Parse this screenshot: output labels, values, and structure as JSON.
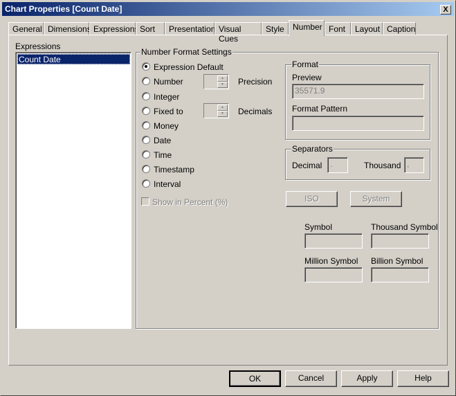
{
  "window": {
    "title": "Chart Properties [Count Date]",
    "close": "X"
  },
  "tabs": [
    "General",
    "Dimensions",
    "Expressions",
    "Sort",
    "Presentation",
    "Visual Cues",
    "Style",
    "Number",
    "Font",
    "Layout",
    "Caption"
  ],
  "expressions": {
    "label": "Expressions",
    "items": [
      "Count Date"
    ]
  },
  "number_format": {
    "label": "Number Format Settings",
    "options": [
      "Expression Default",
      "Number",
      "Integer",
      "Fixed to",
      "Money",
      "Date",
      "Time",
      "Timestamp",
      "Interval"
    ],
    "selected": "Expression Default",
    "precision_label": "Precision",
    "decimals_label": "Decimals",
    "show_percent": "Show in Percent (%)"
  },
  "format": {
    "label": "Format",
    "preview_label": "Preview",
    "preview_value": "35571.9",
    "pattern_label": "Format Pattern",
    "pattern_value": ""
  },
  "separators": {
    "label": "Separators",
    "decimal_label": "Decimal",
    "decimal_value": ".",
    "thousand_label": "Thousand",
    "thousand_value": ","
  },
  "buttons": {
    "iso": "ISO",
    "system": "System",
    "ok": "OK",
    "cancel": "Cancel",
    "apply": "Apply",
    "help": "Help"
  },
  "symbols": {
    "symbol": "Symbol",
    "thousand": "Thousand Symbol",
    "million": "Million Symbol",
    "billion": "Billion Symbol"
  }
}
